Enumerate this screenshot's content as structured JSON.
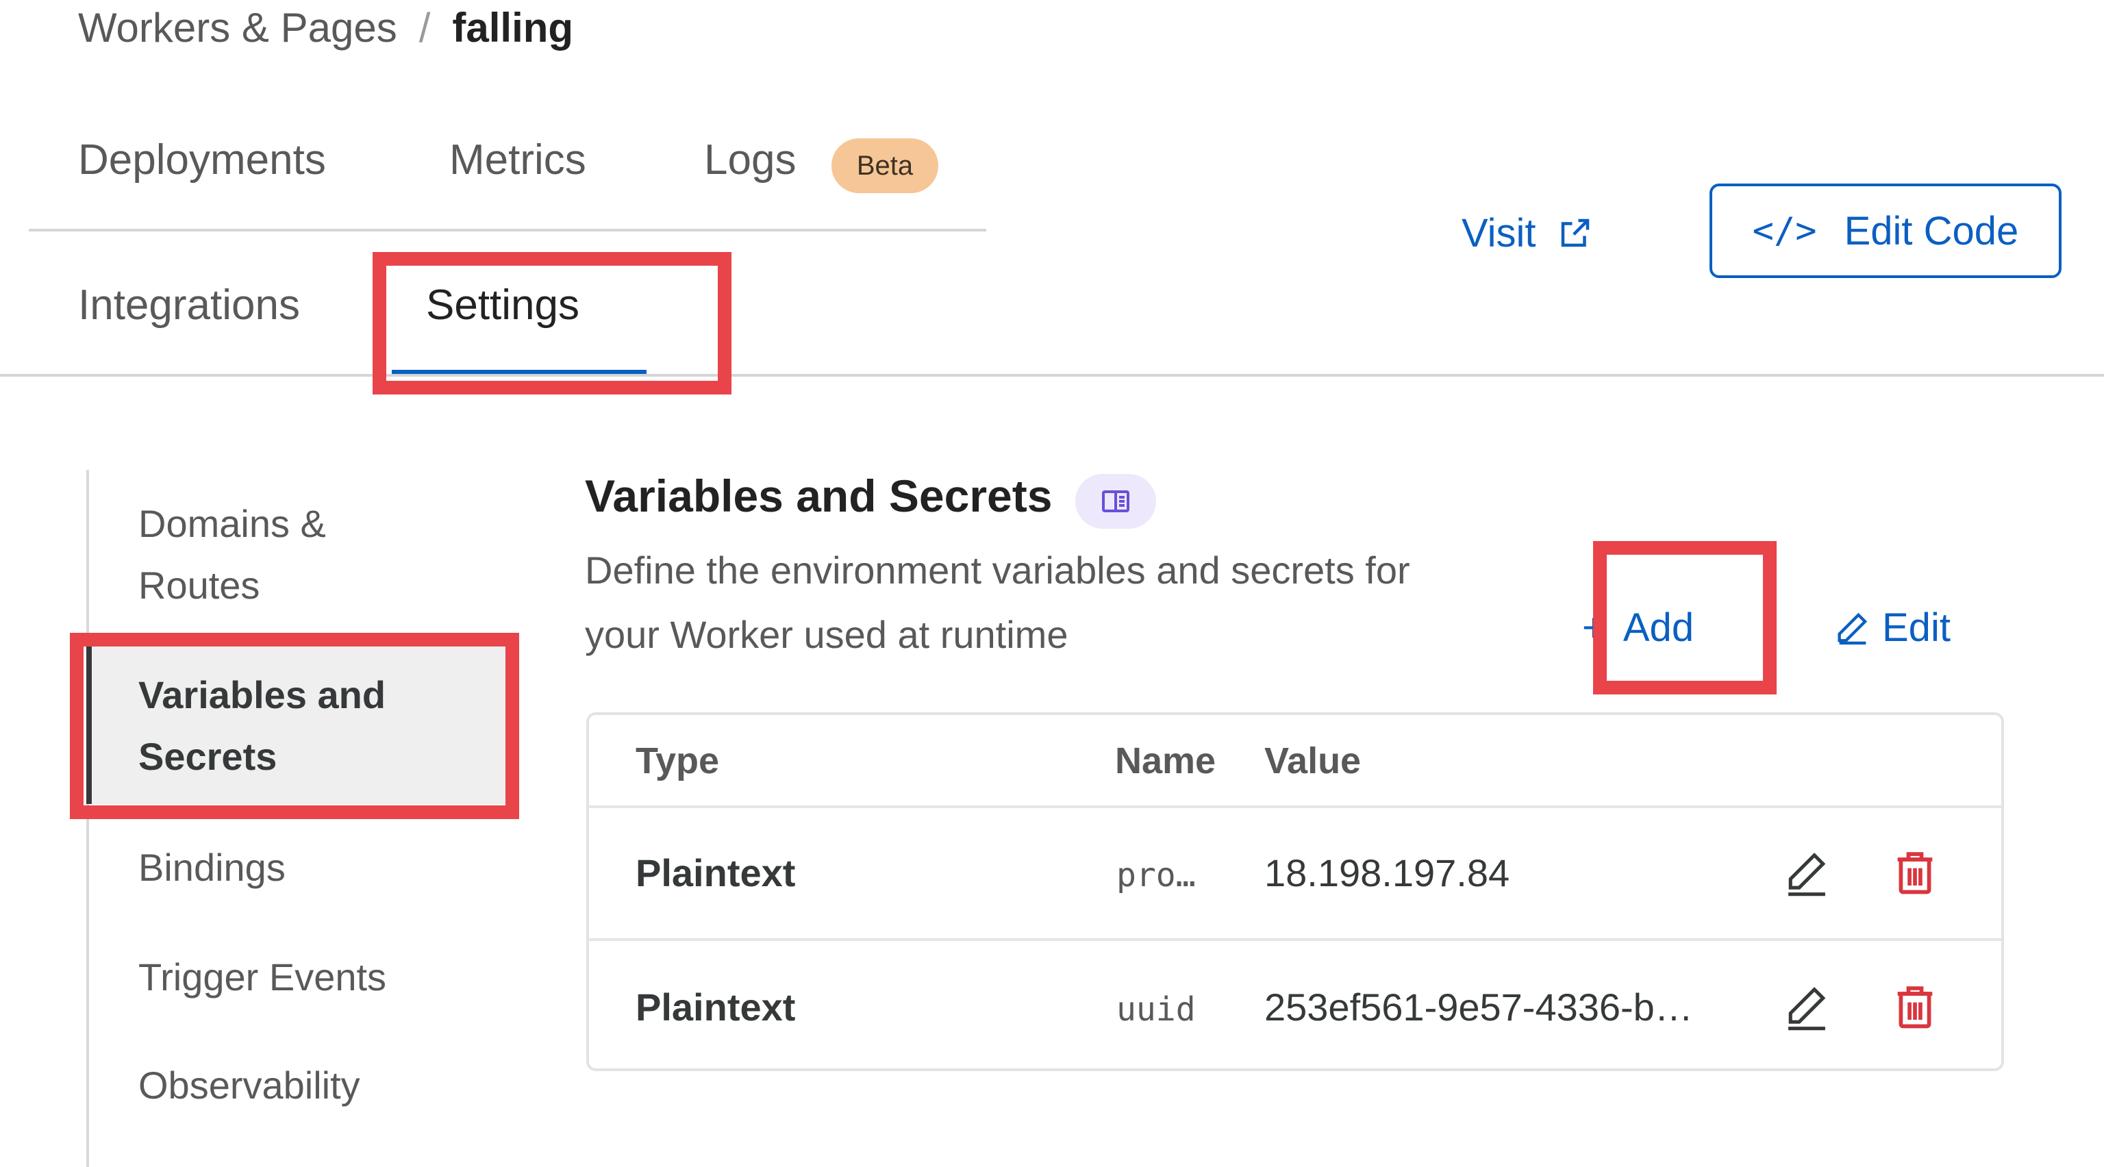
{
  "breadcrumb": {
    "parent": "Workers & Pages",
    "separator": "/",
    "current": "falling"
  },
  "tabs": {
    "row1": [
      {
        "label": "Deployments"
      },
      {
        "label": "Metrics"
      },
      {
        "label": "Logs",
        "badge": "Beta"
      }
    ],
    "row2": [
      {
        "label": "Integrations"
      },
      {
        "label": "Settings",
        "active": true
      }
    ]
  },
  "actions": {
    "visit_label": "Visit",
    "edit_code_label": "Edit Code"
  },
  "sidebar": {
    "items": [
      {
        "label": "Domains & Routes"
      },
      {
        "label": "Variables and Secrets",
        "active": true
      },
      {
        "label": "Bindings"
      },
      {
        "label": "Trigger Events"
      },
      {
        "label": "Observability"
      }
    ]
  },
  "section": {
    "title": "Variables and Secrets",
    "description": "Define the environment variables and secrets for your Worker used at runtime",
    "add_label": "Add",
    "edit_label": "Edit"
  },
  "table": {
    "columns": [
      "Type",
      "Name",
      "Value"
    ],
    "rows": [
      {
        "type": "Plaintext",
        "name": "pro…",
        "value": "18.198.197.84"
      },
      {
        "type": "Plaintext",
        "name": "uuid",
        "value": "253ef561-9e57-4336-b…"
      }
    ]
  },
  "colors": {
    "accent": "#0a5fc2",
    "highlight": "#e8444a",
    "danger": "#d9363e",
    "beta_badge": "#f7c696"
  }
}
